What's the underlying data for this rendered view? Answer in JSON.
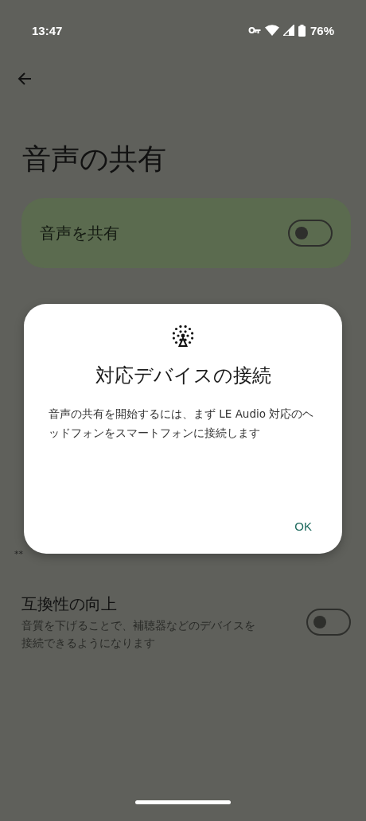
{
  "status_bar": {
    "time": "13:47",
    "battery": "76%"
  },
  "title": "音声の共有",
  "share_card": {
    "label": "音声を共有",
    "on": false
  },
  "hidden_fragment": "**",
  "compatibility": {
    "title": "互換性の向上",
    "description": "音質を下げることで、補聴器などのデバイスを接続できるようになります",
    "on": false
  },
  "dialog": {
    "title": "対応デバイスの接続",
    "message": "音声の共有を開始するには、まず LE Audio 対応のヘッドフォンをスマートフォンに接続します",
    "buttons": [
      "OK"
    ]
  }
}
